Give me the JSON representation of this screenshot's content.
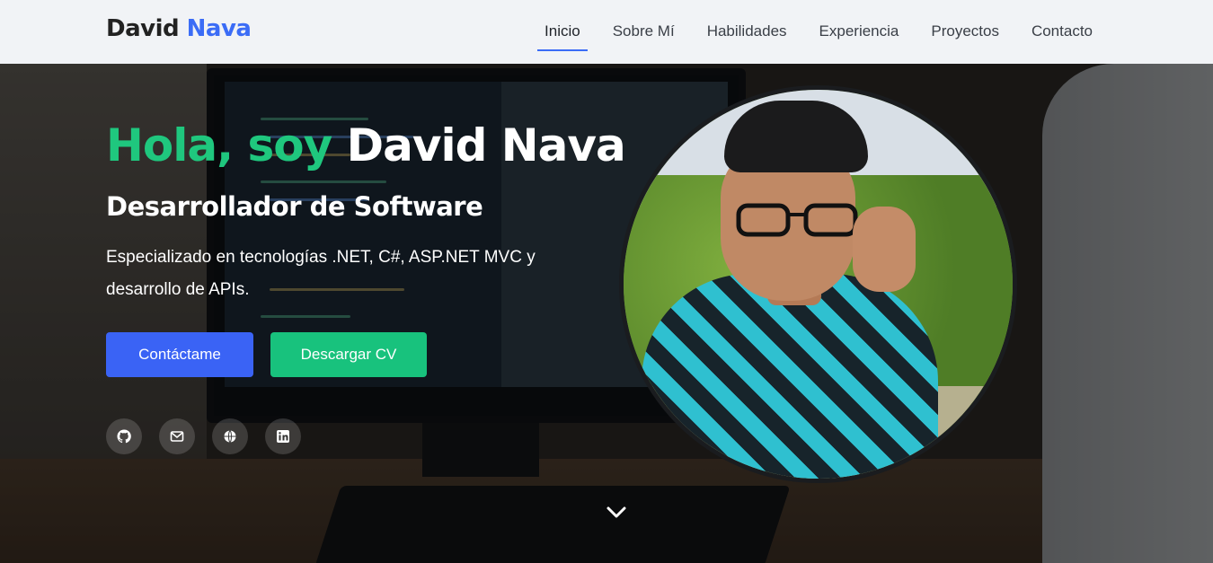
{
  "brand": {
    "first": "David",
    "last": "Nava"
  },
  "nav": {
    "items": [
      {
        "label": "Inicio",
        "active": true
      },
      {
        "label": "Sobre Mí",
        "active": false
      },
      {
        "label": "Habilidades",
        "active": false
      },
      {
        "label": "Experiencia",
        "active": false
      },
      {
        "label": "Proyectos",
        "active": false
      },
      {
        "label": "Contacto",
        "active": false
      }
    ]
  },
  "hero": {
    "greeting": "Hola, soy",
    "name": "David Nava",
    "subtitle": "Desarrollador de Software",
    "description": "Especializado en tecnologías .NET, C#, ASP.NET MVC y desarrollo de APIs.",
    "contact_button": "Contáctame",
    "cv_button": "Descargar CV",
    "socials": [
      {
        "icon": "github-icon"
      },
      {
        "icon": "mail-icon"
      },
      {
        "icon": "globe-icon"
      },
      {
        "icon": "linkedin-icon"
      }
    ],
    "scroll_icon": "chevron-down-icon"
  },
  "colors": {
    "accent_blue": "#3b6cf6",
    "accent_green": "#1fc77e",
    "button_blue": "#3a63f5",
    "button_green": "#18c27d",
    "nav_bg": "#f1f3f6"
  }
}
